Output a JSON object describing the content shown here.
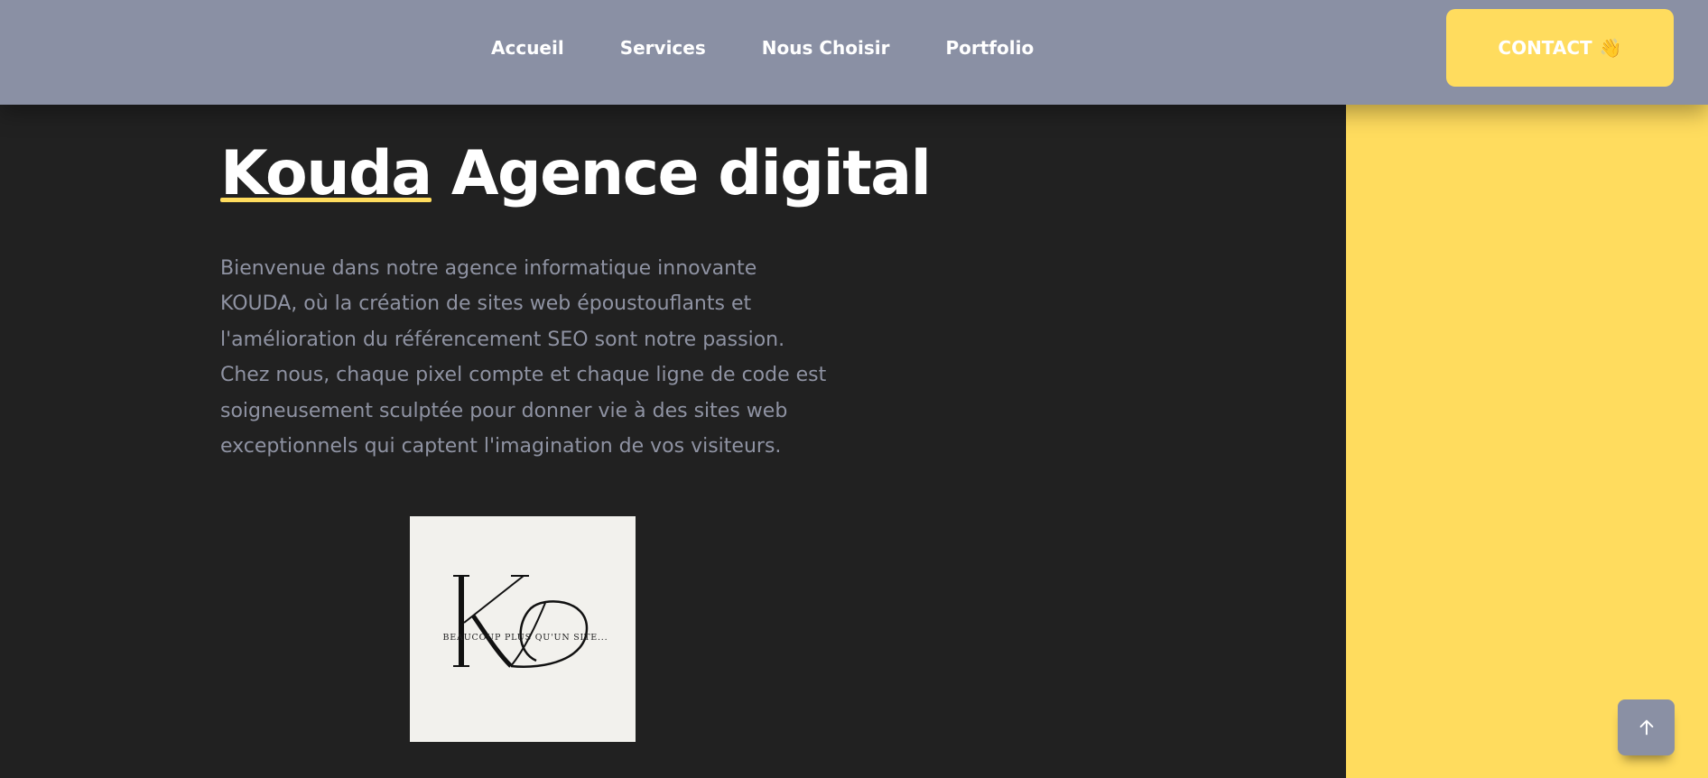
{
  "nav": {
    "items": [
      {
        "label": "Accueil"
      },
      {
        "label": "Services"
      },
      {
        "label": "Nous Choisir"
      },
      {
        "label": "Portfolio"
      }
    ],
    "contact_label": "CONTACT",
    "contact_emoji": "👋"
  },
  "hero": {
    "brand": "Kouda",
    "title_rest": "Agence digital",
    "description": "Bienvenue dans notre agence informatique innovante KOUDA, où la création de sites web époustouflants et l'amélioration du référencement SEO sont notre passion. Chez nous, chaque pixel compte et chaque ligne de code est soigneusement sculptée pour donner vie à des sites web exceptionnels qui captent l'imagination de vos visiteurs."
  },
  "logo": {
    "tagline": "BEAUCOUP PLUS QU'UN SITE..."
  },
  "colors": {
    "navbar": "#8a90a4",
    "accent": "#ffdc5e",
    "background": "#212121",
    "body_text": "#8f93a3"
  },
  "icons": {
    "scroll_top": "arrow-up-icon"
  }
}
